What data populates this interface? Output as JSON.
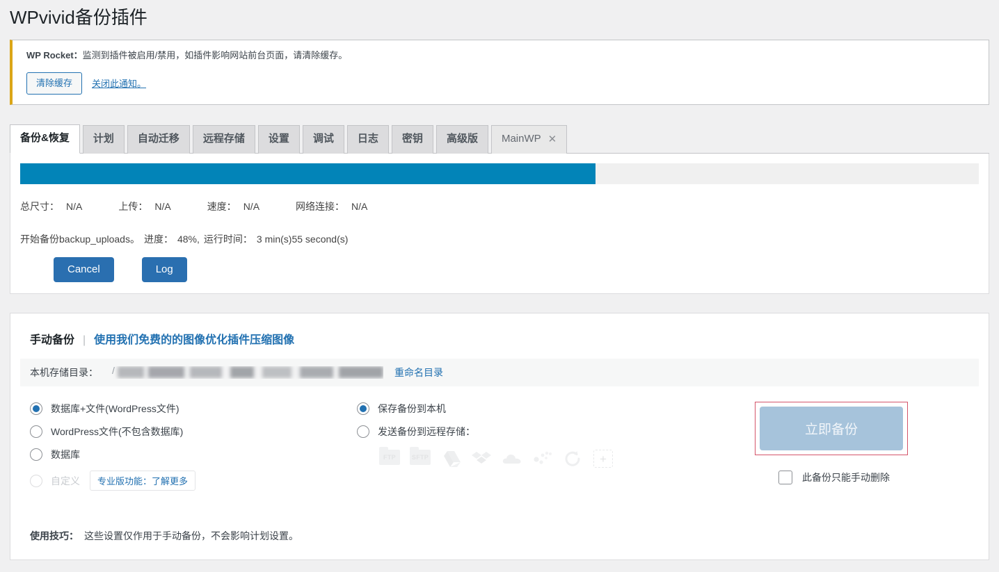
{
  "page": {
    "title": "WPvivid备份插件"
  },
  "notice": {
    "prefix": "WP Rocket：",
    "message": "监测到插件被启用/禁用，如插件影响网站前台页面，请清除缓存。",
    "clear_cache_button": "清除缓存",
    "dismiss_link": "关闭此通知。",
    "accent_color": "#dba617"
  },
  "tabs": [
    {
      "label": "备份&恢复",
      "active": true,
      "closable": false
    },
    {
      "label": "计划",
      "active": false,
      "closable": false
    },
    {
      "label": "自动迁移",
      "active": false,
      "closable": false
    },
    {
      "label": "远程存储",
      "active": false,
      "closable": false
    },
    {
      "label": "设置",
      "active": false,
      "closable": false
    },
    {
      "label": "调试",
      "active": false,
      "closable": false
    },
    {
      "label": "日志",
      "active": false,
      "closable": false
    },
    {
      "label": "密钥",
      "active": false,
      "closable": false
    },
    {
      "label": "高级版",
      "active": false,
      "closable": false
    },
    {
      "label": "MainWP",
      "active": false,
      "closable": true,
      "close_glyph": "✕"
    }
  ],
  "progress": {
    "percent_fill": 60,
    "bar_color": "#0284b8",
    "track_color": "#f0f0f0",
    "stats": [
      {
        "label": "总尺寸：",
        "value": "N/A"
      },
      {
        "label": "上传：",
        "value": "N/A"
      },
      {
        "label": "速度：",
        "value": "N/A"
      },
      {
        "label": "网络连接：",
        "value": "N/A"
      }
    ],
    "status_task": "开始备份backup_uploads。",
    "status_progress_label": "进度：",
    "status_progress_value": "48%,",
    "status_time_label": "运行时间：",
    "status_time_value": "3 min(s)55 second(s)",
    "cancel_button": "Cancel",
    "log_button": "Log"
  },
  "manual_backup": {
    "title": "手动备份",
    "divider": "|",
    "promo_link": "使用我们免费的的图像优化插件压缩图像",
    "directory_label": "本机存储目录：",
    "directory_path_prefix": "/",
    "directory_path_value": "",
    "rename_link": "重命名目录",
    "backup_type_options": [
      {
        "label": "数据库+文件(WordPress文件)",
        "checked": true,
        "disabled": false
      },
      {
        "label": "WordPress文件(不包含数据库)",
        "checked": false,
        "disabled": false
      },
      {
        "label": "数据库",
        "checked": false,
        "disabled": false
      },
      {
        "label": "自定义",
        "checked": false,
        "disabled": true,
        "badge": "专业版功能：了解更多"
      }
    ],
    "destination_options": [
      {
        "label": "保存备份到本机",
        "checked": true
      },
      {
        "label": "发送备份到远程存储：",
        "checked": false
      }
    ],
    "storage_icons": [
      {
        "name": "ftp-icon",
        "label": "FTP"
      },
      {
        "name": "sftp-icon",
        "label": "SFTP"
      },
      {
        "name": "google-drive-icon",
        "label": ""
      },
      {
        "name": "dropbox-icon",
        "label": ""
      },
      {
        "name": "onedrive-icon",
        "label": ""
      },
      {
        "name": "amazon-s3-icon",
        "label": ""
      },
      {
        "name": "backblaze-icon",
        "label": ""
      },
      {
        "name": "add-storage-icon",
        "label": "+"
      }
    ],
    "backup_now_button": "立即备份",
    "backup_now_disabled": true,
    "highlight_border_color": "#d4546a",
    "manual_delete_checkbox_label": "此备份只能手动删除",
    "manual_delete_checked": false,
    "tips_label": "使用技巧：",
    "tips_text": "这些设置仅作用于手动备份，不会影响计划设置。"
  }
}
